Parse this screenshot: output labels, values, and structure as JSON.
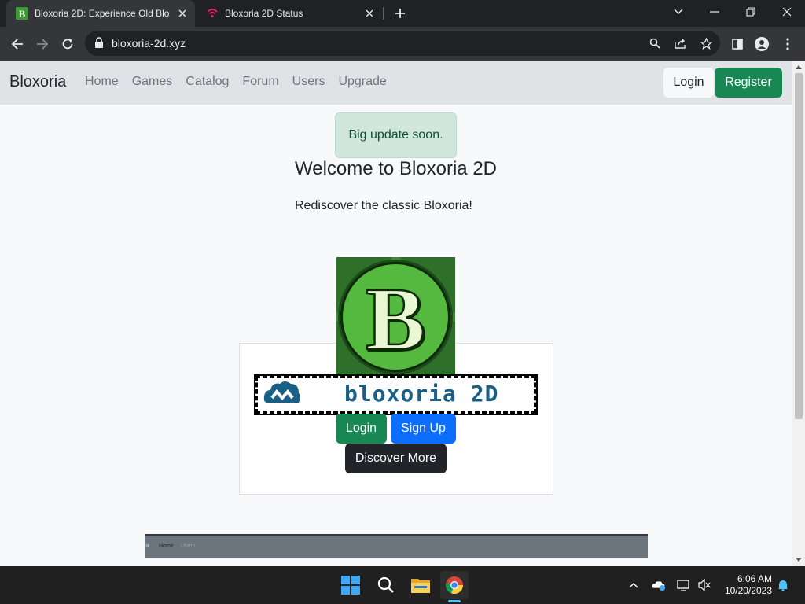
{
  "browser": {
    "tabs": [
      {
        "title": "Bloxoria 2D: Experience Old Blox",
        "active": true,
        "favicon_letter": "B"
      },
      {
        "title": "Bloxoria 2D Status",
        "active": false
      }
    ],
    "url": "bloxoria-2d.xyz"
  },
  "site": {
    "brand": "Bloxoria",
    "nav_links": [
      "Home",
      "Games",
      "Catalog",
      "Forum",
      "Users",
      "Upgrade"
    ],
    "login_label": "Login",
    "register_label": "Register",
    "alert": "Big update soon.",
    "welcome": "Welcome to Bloxoria 2D",
    "subtitle": "Rediscover the classic Bloxoria!",
    "logo_letter": "B",
    "banner_text": "bloxoria 2D",
    "card_login_label": "Login",
    "card_signup_label": "Sign Up",
    "discover_label": "Discover More",
    "preview_links": [
      "ia",
      "Home",
      "Users"
    ]
  },
  "taskbar": {
    "time": "6:06 AM",
    "date": "10/20/2023"
  },
  "colors": {
    "success": "#198754",
    "primary": "#0d6efd",
    "dark": "#212529",
    "alert_bg": "#d1e7dd",
    "banner_blue": "#1a5f86"
  }
}
